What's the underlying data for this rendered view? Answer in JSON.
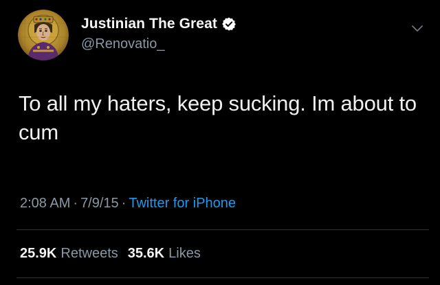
{
  "author": {
    "display_name": "Justinian The Great",
    "handle": "@Renovatio_",
    "verified_icon": "verified-badge-icon",
    "avatar_icon": "mosaic-portrait-avatar"
  },
  "tweet": {
    "text": "To all my haters, keep sucking. Im about to cum",
    "time": "2:08 AM",
    "date": "7/9/15",
    "source": "Twitter for iPhone",
    "separator": "·"
  },
  "stats": {
    "retweets_count": "25.9K",
    "retweets_label": "Retweets",
    "likes_count": "35.6K",
    "likes_label": "Likes"
  },
  "colors": {
    "background": "#000000",
    "primary_text": "#f0f0f0",
    "secondary_text": "#8b98a5",
    "link": "#1d9bf0",
    "verified_badge": "#ffffff"
  },
  "menu_icon": "chevron-down-icon"
}
